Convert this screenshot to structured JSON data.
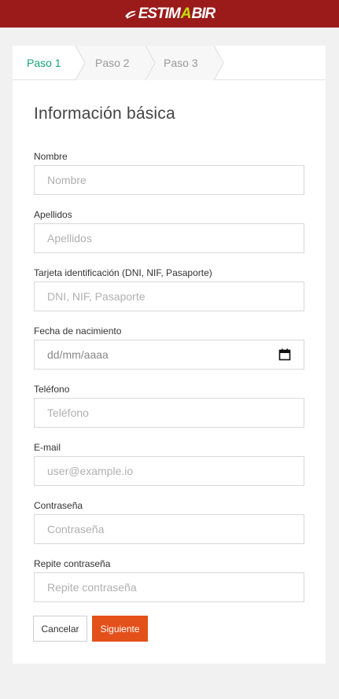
{
  "header": {
    "logo_prefix": "ESTIM",
    "logo_highlight": "A",
    "logo_suffix": "BIR",
    "bg_color": "#9b1b1b",
    "highlight_color": "#c4e000"
  },
  "steps": [
    {
      "label": "Paso 1",
      "active": true
    },
    {
      "label": "Paso 2",
      "active": false
    },
    {
      "label": "Paso 3",
      "active": false
    }
  ],
  "form": {
    "title": "Información básica",
    "fields": {
      "nombre": {
        "label": "Nombre",
        "placeholder": "Nombre"
      },
      "apellidos": {
        "label": "Apellidos",
        "placeholder": "Apellidos"
      },
      "tarjeta": {
        "label": "Tarjeta identificación (DNI, NIF, Pasaporte)",
        "placeholder": "DNI, NIF, Pasaporte"
      },
      "fecha": {
        "label": "Fecha de nacimiento",
        "placeholder": "dd/mm/aaaa",
        "icon": "calendar-icon"
      },
      "telefono": {
        "label": "Teléfono",
        "placeholder": "Teléfono"
      },
      "email": {
        "label": "E-mail",
        "placeholder": "user@example.io"
      },
      "password": {
        "label": "Contraseña",
        "placeholder": "Contraseña"
      },
      "password_repeat": {
        "label": "Repite contraseña",
        "placeholder": "Repite contraseña"
      }
    },
    "buttons": {
      "cancel": "Cancelar",
      "next": "Siguiente"
    }
  },
  "colors": {
    "active_step": "#1aa37a",
    "primary_button": "#e4501a"
  }
}
